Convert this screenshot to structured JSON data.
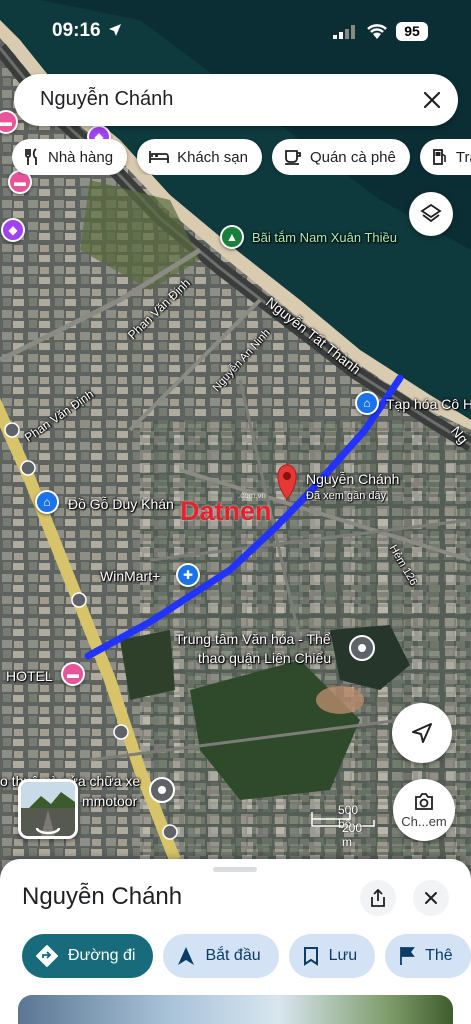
{
  "status_bar": {
    "time": "09:16",
    "battery": "95"
  },
  "search": {
    "query": "Nguyễn Chánh"
  },
  "chips": [
    {
      "label": "Nhà hàng",
      "icon": "restaurant-icon"
    },
    {
      "label": "Khách sạn",
      "icon": "hotel-icon"
    },
    {
      "label": "Quán cà phê",
      "icon": "coffee-icon"
    },
    {
      "label": "Trạm xăng",
      "icon": "gas-icon"
    }
  ],
  "map": {
    "labels": {
      "beach": "Bãi tắm Nam Xuân Thiều",
      "road_nguyen_tat_thanh": "Nguyễn Tất Thành",
      "road_phan_van_dinh_1": "Phan Văn Định",
      "road_phan_van_dinh_2": "Phan Văn Định",
      "road_nguyen_an_ninh": "Nguyễn An Ninh",
      "grocery": "Tạp hóa Cô H",
      "wood": "Đồ Gỗ Duy Khán",
      "winmart": "WinMart+",
      "culture_center_1": "Trung tâm Văn hóa - Thể",
      "culture_center_2": "thao quận Liên Chiểu",
      "hotel": "HOTEL",
      "repair_1": "o thuê và sửa chữa xe",
      "repair_2": "mmotoor",
      "alley": "Hẻm 126",
      "road_ng": "Ng",
      "place_name": "Nguyễn Chánh",
      "place_sub": "Đã xem gần đây",
      "scale_ft": "500 bộ",
      "scale_m": "200 m"
    },
    "lens_label": "Ch...em"
  },
  "watermark": {
    "text": "Datnen",
    "sub": ".com.vn"
  },
  "sheet": {
    "title": "Nguyễn Chánh",
    "actions": [
      {
        "label": "Đường đi",
        "icon": "directions-icon"
      },
      {
        "label": "Bắt đầu",
        "icon": "navigation-icon"
      },
      {
        "label": "Lưu",
        "icon": "bookmark-icon"
      },
      {
        "label": "Thê",
        "icon": "flag-icon"
      }
    ]
  },
  "colors": {
    "route": "#2233ff",
    "pin": "#e53935",
    "primary": "#176b7a"
  }
}
